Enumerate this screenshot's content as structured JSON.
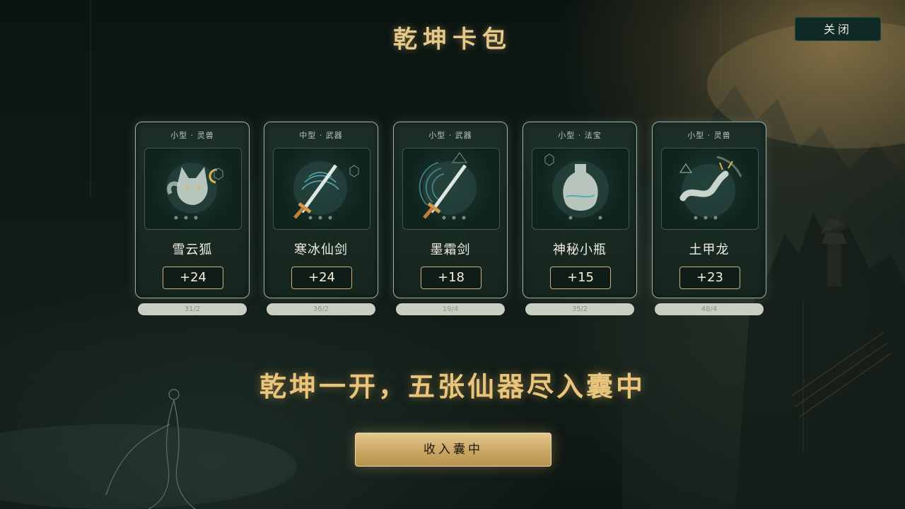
{
  "header": {
    "title": "乾坤卡包",
    "close_label": "关闭"
  },
  "cards": [
    {
      "type": "小型 · 灵兽",
      "name": "雪云狐",
      "value": "+24",
      "bar_text": "31/2",
      "icon": "fox-icon"
    },
    {
      "type": "中型 · 武器",
      "name": "寒冰仙剑",
      "value": "+24",
      "bar_text": "36/2",
      "icon": "ice-sword-icon"
    },
    {
      "type": "小型 · 武器",
      "name": "墨霜剑",
      "value": "+18",
      "bar_text": "19/4",
      "icon": "frost-sword-icon"
    },
    {
      "type": "小型 · 法宝",
      "name": "神秘小瓶",
      "value": "+15",
      "bar_text": "35/2",
      "icon": "bottle-icon"
    },
    {
      "type": "小型 · 灵兽",
      "name": "土甲龙",
      "value": "+23",
      "bar_text": "48/4",
      "icon": "earth-dragon-icon"
    }
  ],
  "tagline": "乾坤一开，五张仙器尽入囊中",
  "collect_label": "收入囊中",
  "colors": {
    "accent_gold": "#e6c98a",
    "card_border": "#9fb3a7",
    "button_gold": "#c9a663",
    "close_bg": "#0f2a24"
  }
}
